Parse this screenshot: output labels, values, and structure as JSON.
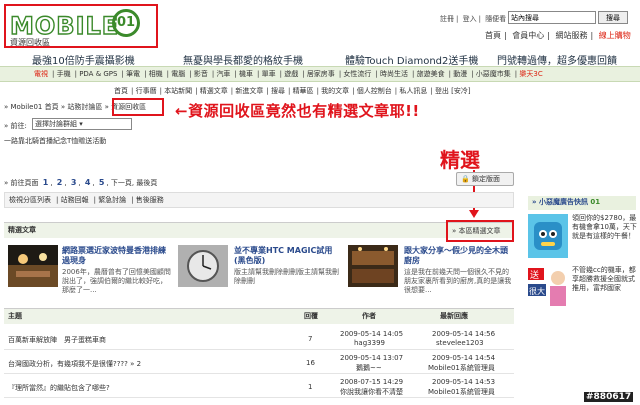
{
  "logo": {
    "text": "MOBILE",
    "badge": "01",
    "subtitle": "資源回收區"
  },
  "top_links": [
    "註冊",
    "登入",
    "隨便看",
    "站內搜尋"
  ],
  "search": {
    "value": "站內搜尋",
    "button": "搜尋"
  },
  "user_nav": [
    "首頁",
    "會員中心",
    "網站服務",
    "線上購物"
  ],
  "promos": [
    "最強10倍防手震攝影機",
    "無憂與學長都愛的格紋手機",
    "體驗Touch Diamond2送手機",
    "門號轉過傳，超多優惠回饋"
  ],
  "categories": [
    "電視",
    "手機",
    "PDA & GPS",
    "筆電",
    "相機",
    "電腦",
    "影音",
    "汽車",
    "機車",
    "單車",
    "遊戲",
    "居家房事",
    "女性流行",
    "時尚生活",
    "旅遊美食",
    "動漫",
    "小惡魔市集",
    "樂天3C"
  ],
  "sub_nav": [
    "首頁",
    "行事曆",
    "本站新聞",
    "精選文章",
    "新進文章",
    "搜尋",
    "精華區",
    "我的文章",
    "個人控制台",
    "私人訊息",
    "登出 [安冷]"
  ],
  "breadcrumb": [
    "Mobile01",
    "首頁",
    "»",
    "站務討論區",
    "»",
    "資源回收區"
  ],
  "goto": {
    "label": "» 前往:",
    "select": "選擇討論群組"
  },
  "activity": "一路靠北騎首播紀念T恤贈送活動",
  "annotations": {
    "top": "←資源回收區竟然也有精選文章耶!!",
    "right": "精選"
  },
  "pager": {
    "label": "» 前往頁面",
    "pages": [
      "1",
      "2",
      "3",
      "4",
      "5"
    ],
    "next": "下一頁",
    "last": "最後頁"
  },
  "lock": "鎖定版面",
  "toolbar": [
    "檢視分區列表",
    "站務回報",
    "緊急討論",
    "售後服務"
  ],
  "featured": {
    "header": "精選文章",
    "more": "» 本區精選文章",
    "items": [
      {
        "title": "網路票選近家波特曼香港排練過現身",
        "desc": "2006年，農曆曾有了回憶美國顧問說出了，強調伯爾的繼比較好吃，那麼了一..."
      },
      {
        "title": "並不專業HTC MAGIC試用(黑色版)",
        "desc": "版主請幫我刪除刪刪版主請幫我刪除刪刪"
      },
      {
        "title": "跟大家分享～假少見的全木頭廚房",
        "desc": "這是我在前幾天問一個很久不見的朋友家裏所看到的廚房,真的是讓我很想要..."
      }
    ]
  },
  "table": {
    "headers": [
      "主題",
      "回覆",
      "作者",
      "最新回應"
    ],
    "rows": [
      {
        "topic": "百萬新車解放陣　男子蛋糕車商",
        "replies": "7",
        "author_time": "2009-05-14 14:05",
        "author_name": "hag3399",
        "latest_time": "2009-05-14 14:56",
        "latest_name": "stevelee1203"
      },
      {
        "topic": "台灣國政分析，有幾項我不是很懂???? » 2",
        "replies": "16",
        "author_time": "2009-05-14 13:07",
        "author_name": "鵝鵝~~",
        "latest_time": "2009-05-14 14:54",
        "latest_name": "Mobile01系統管理員"
      },
      {
        "topic": "『理所當然』的繼貼包含了哪些?",
        "replies": "1",
        "author_time": "2008-07-15 14:29",
        "author_name": "你說我讓你看不清楚",
        "latest_time": "2009-05-14 14:53",
        "latest_name": "Mobile01系統管理員"
      }
    ]
  },
  "sidebar": {
    "header": "» 小惡魔廣告快訊",
    "badge": "01",
    "ad1": "領回你的$2780，最有機會拿10萬，天下就是有這樣的午餐！",
    "ad2": "不管幾cc的機車，都享超勝救援全國就式推用，富邦國家"
  },
  "watermark": "#880617",
  "colors": {
    "accent_red": "#e0141c",
    "brand_green": "#3b8a2b",
    "link_blue": "#2a4a8c"
  }
}
